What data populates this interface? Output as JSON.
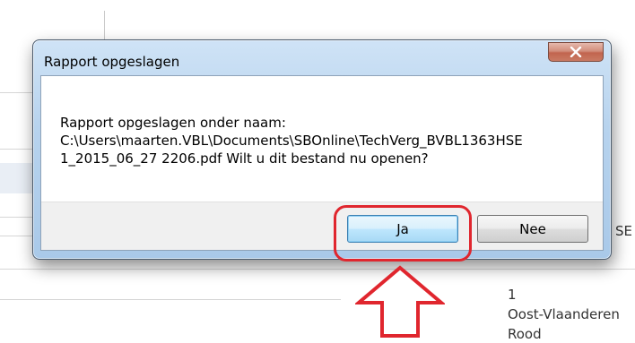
{
  "background": {
    "side_text": "SE",
    "row_value": "1",
    "row_region": "Oost-Vlaanderen",
    "row_color": "Rood"
  },
  "dialog": {
    "title": "Rapport opgeslagen",
    "message": "Rapport opgeslagen onder naam:\nC:\\Users\\maarten.VBL\\Documents\\SBOnline\\TechVerg_BVBL1363HSE\n1_2015_06_27 2206.pdf Wilt u dit bestand nu openen?",
    "buttons": {
      "yes_label": "Ja",
      "no_label": "Nee"
    }
  },
  "colors": {
    "annotation": "#e0262e"
  },
  "icons": {
    "close": "close-icon",
    "arrow": "arrow-up-icon"
  }
}
